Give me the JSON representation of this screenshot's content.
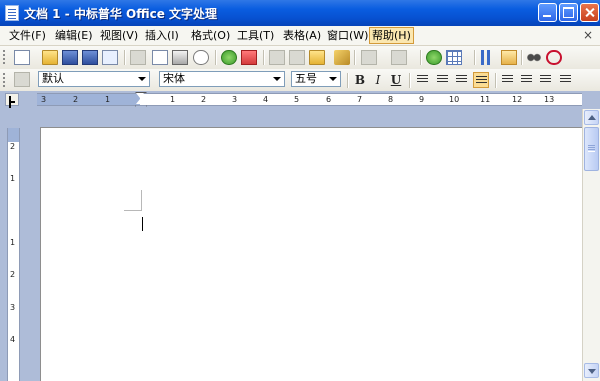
{
  "window": {
    "title": "文档 1 - 中标普华 Office 文字处理",
    "icons": {
      "app": "document-icon",
      "min": "minimize-icon",
      "max": "maximize-icon",
      "close": "close-icon"
    }
  },
  "menu": {
    "items": [
      {
        "label": "文件(F)"
      },
      {
        "label": "编辑(E)"
      },
      {
        "label": "视图(V)"
      },
      {
        "label": "插入(I)"
      },
      {
        "label": "格式(O)"
      },
      {
        "label": "工具(T)"
      },
      {
        "label": "表格(A)"
      },
      {
        "label": "窗口(W)"
      },
      {
        "label": "帮助(H)"
      }
    ],
    "active_index": 8,
    "close_glyph": "×"
  },
  "format_toolbar": {
    "style": "默认",
    "font": "宋体",
    "size": "五号",
    "bold": "B",
    "italic": "I",
    "underline": "U"
  },
  "ruler": {
    "labels": [
      "3",
      "2",
      "1",
      "1",
      "2",
      "3",
      "4",
      "5",
      "6",
      "7",
      "8",
      "9",
      "10",
      "11",
      "12",
      "13"
    ],
    "vertical_labels": [
      "2",
      "1",
      "1",
      "2",
      "3",
      "4"
    ]
  },
  "colors": {
    "titlebar": "#0a5de0",
    "background": "#aebcd8",
    "menu_active": "#fbe7b0"
  }
}
